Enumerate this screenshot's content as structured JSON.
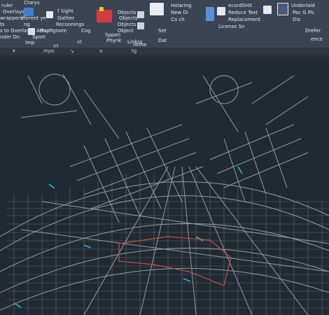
{
  "ribbon": {
    "col1": [
      "ruler",
      "Overlays",
      "wrappers",
      "ts",
      "s to Overlays",
      "nder On"
    ],
    "col2": [
      "Ctarys",
      "ifferent ye",
      "ng",
      "Attach",
      "Sport",
      "Imp"
    ],
    "col3": [
      "f Sight",
      "Gather",
      "Recoonings",
      "Pop Ignore"
    ],
    "col4": [
      "Objects",
      "Objects",
      "Objects",
      "Object",
      "Cog",
      "Sppen",
      "Phynk",
      "Linkss"
    ],
    "col5": [
      "Holaring",
      "New Di",
      "Co ch",
      "Set",
      "Dat",
      "nkme"
    ],
    "col6": [
      "ecordSHX",
      "Reduce Text",
      "Replacement",
      "License Sn"
    ],
    "col7": [
      "Underlaid",
      "Pac G Pic",
      "Diz",
      "Drefer",
      "ence"
    ],
    "bottom_labels": [
      "mpo",
      "irt",
      "a",
      "xt",
      "tg"
    ]
  },
  "colors": {
    "ribbon_bg": "#3b4453",
    "canvas_bg": "#212933",
    "street": "#b8c0c8",
    "water": "#25a6a0",
    "boundary": "#c0504d"
  }
}
